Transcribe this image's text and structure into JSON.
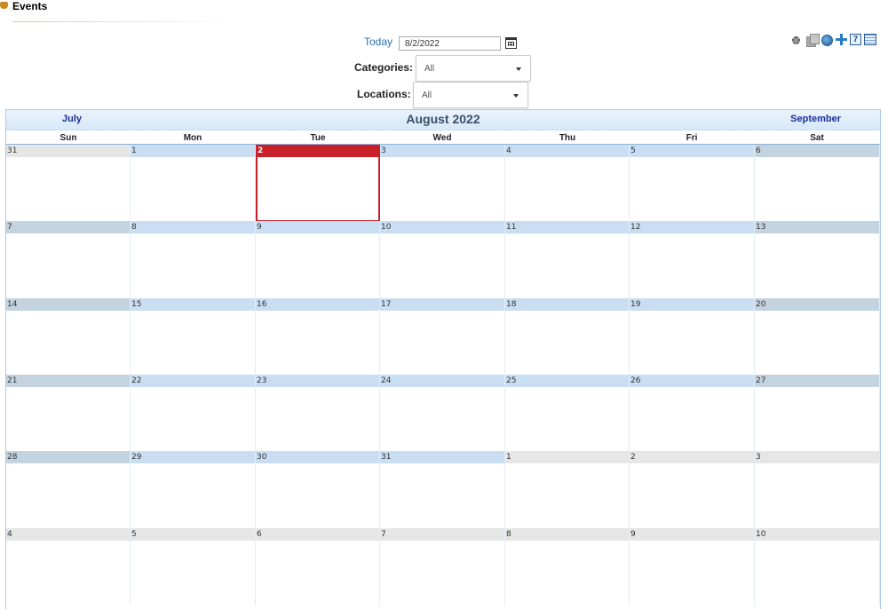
{
  "header": {
    "title": "Events"
  },
  "controls": {
    "today_label": "Today",
    "date_value": "8/2/2022",
    "categories": {
      "label": "Categories:",
      "selected": "All"
    },
    "locations": {
      "label": "Locations:",
      "selected": "All"
    }
  },
  "toolbar": {
    "icons": [
      "gear-icon",
      "copy-icon",
      "refresh-icon",
      "plus-icon",
      "week-view-icon",
      "month-view-icon"
    ],
    "week_icon_text": "7"
  },
  "calendar": {
    "prev_month": "July",
    "title": "August 2022",
    "next_month": "September",
    "weekdays": [
      "Sun",
      "Mon",
      "Tue",
      "Wed",
      "Thu",
      "Fri",
      "Sat"
    ],
    "today": "2",
    "weeks": [
      [
        {
          "d": "31",
          "m": "other"
        },
        {
          "d": "1",
          "m": "cur"
        },
        {
          "d": "2",
          "m": "cur",
          "today": true
        },
        {
          "d": "3",
          "m": "cur"
        },
        {
          "d": "4",
          "m": "cur"
        },
        {
          "d": "5",
          "m": "cur"
        },
        {
          "d": "6",
          "m": "cur"
        }
      ],
      [
        {
          "d": "7",
          "m": "cur"
        },
        {
          "d": "8",
          "m": "cur"
        },
        {
          "d": "9",
          "m": "cur"
        },
        {
          "d": "10",
          "m": "cur"
        },
        {
          "d": "11",
          "m": "cur"
        },
        {
          "d": "12",
          "m": "cur"
        },
        {
          "d": "13",
          "m": "cur"
        }
      ],
      [
        {
          "d": "14",
          "m": "cur"
        },
        {
          "d": "15",
          "m": "cur"
        },
        {
          "d": "16",
          "m": "cur"
        },
        {
          "d": "17",
          "m": "cur"
        },
        {
          "d": "18",
          "m": "cur"
        },
        {
          "d": "19",
          "m": "cur"
        },
        {
          "d": "20",
          "m": "cur"
        }
      ],
      [
        {
          "d": "21",
          "m": "cur"
        },
        {
          "d": "22",
          "m": "cur"
        },
        {
          "d": "23",
          "m": "cur"
        },
        {
          "d": "24",
          "m": "cur"
        },
        {
          "d": "25",
          "m": "cur"
        },
        {
          "d": "26",
          "m": "cur"
        },
        {
          "d": "27",
          "m": "cur"
        }
      ],
      [
        {
          "d": "28",
          "m": "cur"
        },
        {
          "d": "29",
          "m": "cur"
        },
        {
          "d": "30",
          "m": "cur"
        },
        {
          "d": "31",
          "m": "cur"
        },
        {
          "d": "1",
          "m": "other"
        },
        {
          "d": "2",
          "m": "other"
        },
        {
          "d": "3",
          "m": "other"
        }
      ],
      [
        {
          "d": "4",
          "m": "other"
        },
        {
          "d": "5",
          "m": "other"
        },
        {
          "d": "6",
          "m": "other"
        },
        {
          "d": "7",
          "m": "other"
        },
        {
          "d": "8",
          "m": "other"
        },
        {
          "d": "9",
          "m": "other"
        },
        {
          "d": "10",
          "m": "other"
        }
      ]
    ]
  },
  "colors": {
    "today_accent": "#c9202a",
    "day_header_current": "#c9def3",
    "day_header_weekend": "#c4d3e0",
    "day_header_other": "#e6e6e6",
    "nav_link": "#1a2f9a",
    "today_link": "#2a6fb8"
  }
}
